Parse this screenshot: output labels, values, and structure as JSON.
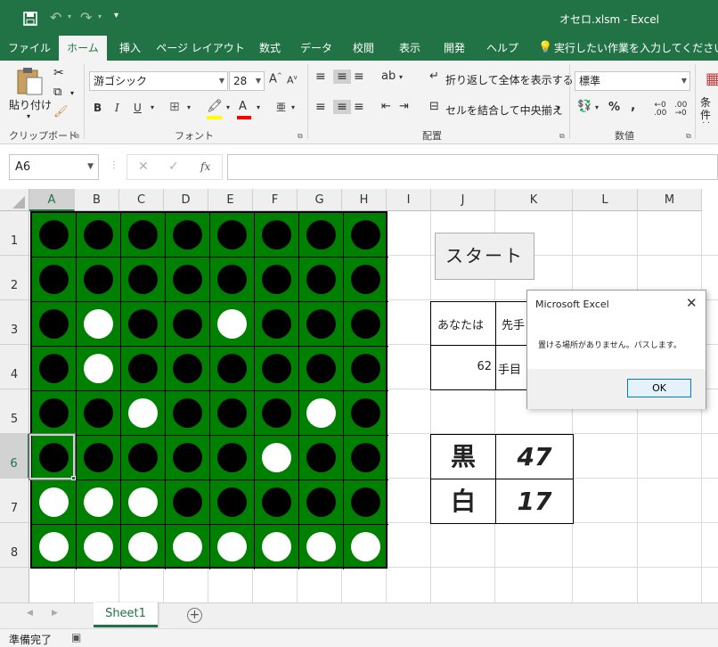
{
  "titlebar": {
    "filename": "オセロ.xlsm",
    "separator": "-",
    "app": "Excel"
  },
  "ribbon_tabs": [
    "ファイル",
    "ホーム",
    "挿入",
    "ページ レイアウト",
    "数式",
    "データ",
    "校閲",
    "表示",
    "開発",
    "ヘルプ"
  ],
  "tellme": "実行したい作業を入力してください",
  "ribbon": {
    "paste": "貼り付け",
    "clipboard_group": "クリップボード",
    "font_name": "游ゴシック",
    "font_size": "28",
    "font_group": "フォント",
    "wrap_text": "折り返して全体を表示する",
    "merge_center": "セルを結合して中央揃え",
    "alignment_group": "配置",
    "number_format": "標準",
    "number_group": "数値",
    "conditional_fmt": "条件付き書"
  },
  "formula_bar": {
    "name_box": "A6",
    "formula": ""
  },
  "columns": [
    "A",
    "B",
    "C",
    "D",
    "E",
    "F",
    "G",
    "H",
    "I",
    "J",
    "K",
    "L",
    "M"
  ],
  "rows": [
    "1",
    "2",
    "3",
    "4",
    "5",
    "6",
    "7",
    "8"
  ],
  "board": [
    [
      "B",
      "B",
      "B",
      "B",
      "B",
      "B",
      "B",
      "B"
    ],
    [
      "B",
      "B",
      "B",
      "B",
      "B",
      "B",
      "B",
      "B"
    ],
    [
      "B",
      "W",
      "B",
      "B",
      "W",
      "B",
      "B",
      "B"
    ],
    [
      "B",
      "W",
      "B",
      "B",
      "B",
      "B",
      "B",
      "B"
    ],
    [
      "B",
      "B",
      "W",
      "B",
      "B",
      "B",
      "W",
      "B"
    ],
    [
      "B",
      "B",
      "B",
      "B",
      "B",
      "W",
      "B",
      "B"
    ],
    [
      "W",
      "W",
      "W",
      "B",
      "B",
      "B",
      "B",
      "B"
    ],
    [
      "W",
      "W",
      "W",
      "W",
      "W",
      "W",
      "W",
      "W"
    ]
  ],
  "start_button": "スタート",
  "info": {
    "you_are": "あなたは",
    "first_player": "先手",
    "move_count": "62",
    "move_label": "手目"
  },
  "score": {
    "black_label": "黒",
    "black_count": "47",
    "white_label": "白",
    "white_count": "17"
  },
  "dialog": {
    "title": "Microsoft Excel",
    "message": "置ける場所がありません。パスします。",
    "ok": "OK"
  },
  "sheet_tab": "Sheet1",
  "status": "準備完了",
  "colors": {
    "excel_green": "#217346",
    "board_green": "#008000"
  }
}
